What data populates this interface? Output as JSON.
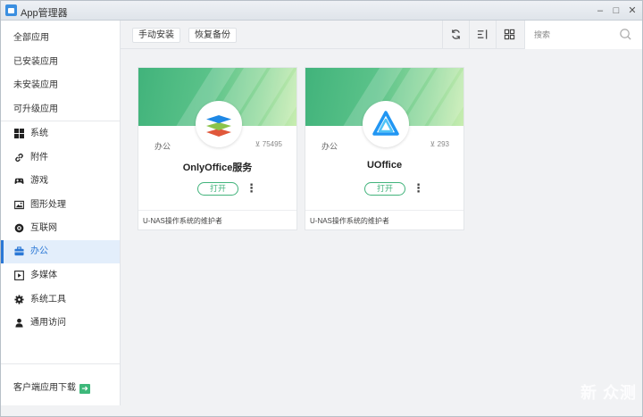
{
  "window": {
    "title": "App管理器",
    "minimize": "–",
    "maximize": "□",
    "close": "✕"
  },
  "sidebar": {
    "top_items": [
      "全部应用",
      "已安装应用",
      "未安装应用",
      "可升级应用"
    ],
    "categories": [
      {
        "label": "系统",
        "icon": "windows-icon"
      },
      {
        "label": "附件",
        "icon": "link-icon"
      },
      {
        "label": "游戏",
        "icon": "gamepad-icon"
      },
      {
        "label": "图形处理",
        "icon": "image-icon"
      },
      {
        "label": "互联网",
        "icon": "globe-icon"
      },
      {
        "label": "办公",
        "icon": "briefcase-icon",
        "active": true
      },
      {
        "label": "多媒体",
        "icon": "play-icon"
      },
      {
        "label": "系统工具",
        "icon": "gear-icon"
      },
      {
        "label": "通用访问",
        "icon": "user-icon"
      }
    ],
    "bottom_link": "客户端应用下载",
    "bottom_icon": "arrow-right-icon"
  },
  "toolbar": {
    "manual_install": "手动安装",
    "restore_backup": "恢复备份",
    "search_placeholder": "搜索",
    "icons": [
      "refresh-icon",
      "sort-icon",
      "grid-icon",
      "search-icon"
    ]
  },
  "apps": [
    {
      "name": "OnlyOffice服务",
      "category": "办公",
      "downloads": "75495",
      "open_label": "打开",
      "more": "⋮",
      "maintainer": "U-NAS操作系统的维护者",
      "icon": "onlyoffice-logo-icon"
    },
    {
      "name": "UOffice",
      "category": "办公",
      "downloads": "293",
      "open_label": "打开",
      "more": "⋮",
      "maintainer": "U-NAS操作系统的维护者",
      "icon": "uoffice-logo-icon"
    }
  ],
  "download_prefix": "⊻",
  "watermark": "新 众测",
  "colors": {
    "accent": "#2b78d6",
    "green": "#41b37b",
    "active_bg": "#e3eefb"
  }
}
